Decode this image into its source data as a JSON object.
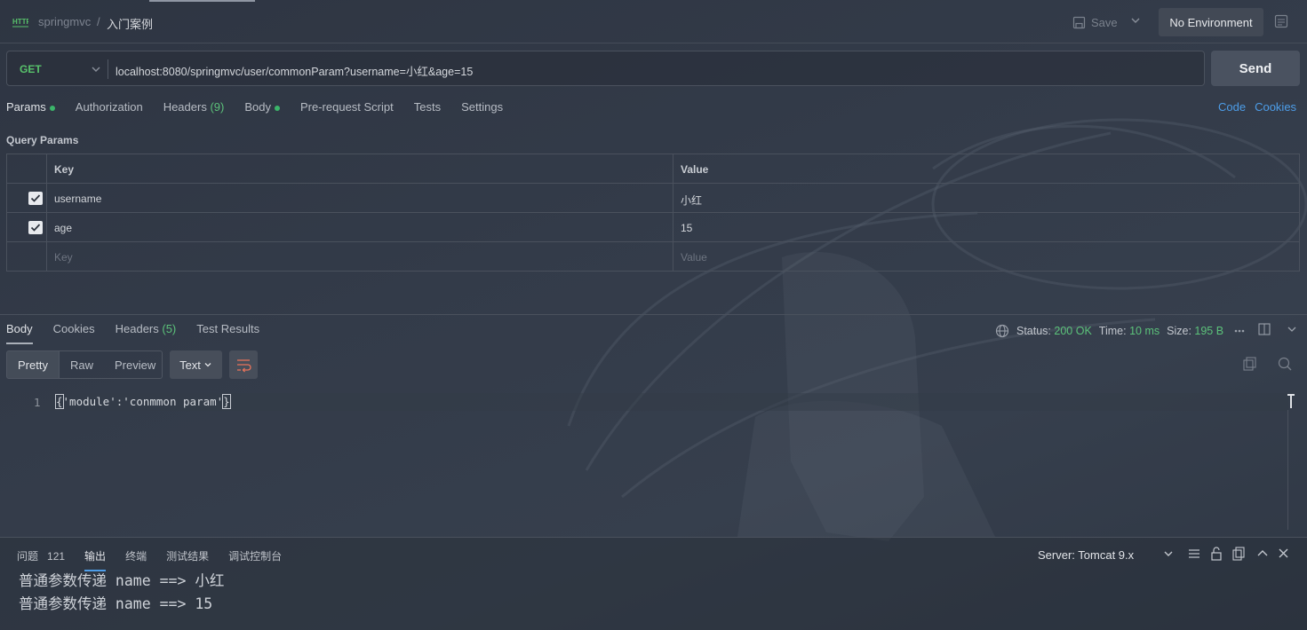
{
  "header": {
    "workspace": "springmvc",
    "separator": "/",
    "request_name": "入门案例",
    "save_label": "Save",
    "environment": "No Environment"
  },
  "request": {
    "method": "GET",
    "url": "localhost:8080/springmvc/user/commonParam?username=小红&age=15",
    "send_label": "Send"
  },
  "request_tabs": {
    "params": "Params",
    "authorization": "Authorization",
    "headers": "Headers",
    "headers_count": "(9)",
    "body": "Body",
    "prerequest": "Pre-request Script",
    "tests": "Tests",
    "settings": "Settings",
    "code": "Code",
    "cookies": "Cookies"
  },
  "query_params": {
    "label": "Query Params",
    "header_key": "Key",
    "header_value": "Value",
    "rows": [
      {
        "key": "username",
        "value": "小红",
        "checked": true
      },
      {
        "key": "age",
        "value": "15",
        "checked": true
      }
    ],
    "placeholder_key": "Key",
    "placeholder_value": "Value"
  },
  "response_tabs": {
    "body": "Body",
    "cookies": "Cookies",
    "headers": "Headers",
    "headers_count": "(5)",
    "test_results": "Test Results"
  },
  "response_status": {
    "status_label": "Status:",
    "status_value": "200 OK",
    "time_label": "Time:",
    "time_value": "10 ms",
    "size_label": "Size:",
    "size_value": "195 B"
  },
  "response_view": {
    "pretty": "Pretty",
    "raw": "Raw",
    "preview": "Preview",
    "format": "Text"
  },
  "response_body": {
    "line_number": "1",
    "open_brace": "{",
    "content": "'module':'conmmon param'",
    "close_brace": "}"
  },
  "bottom_panel": {
    "tabs": {
      "problems": "问题",
      "problems_count": "121",
      "output": "输出",
      "terminal": "终端",
      "test_results": "测试结果",
      "debug_console": "调试控制台"
    },
    "server": "Server: Tomcat 9.x",
    "console_lines": [
      "普通参数传递 name ==> 小红",
      "普通参数传递 name ==> 15"
    ]
  },
  "colors": {
    "accent_green": "#5cc27a",
    "link_blue": "#4d9de8",
    "background": "#333b49"
  }
}
